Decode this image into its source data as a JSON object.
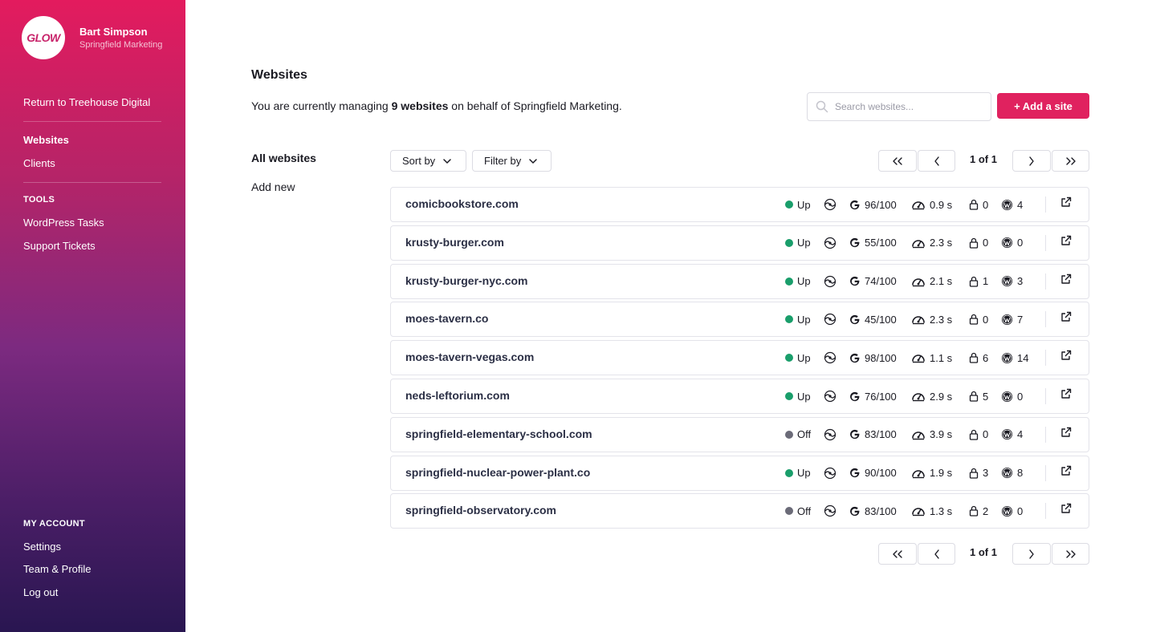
{
  "sidebar": {
    "logo_text": "GLOW",
    "user_name": "Bart Simpson",
    "user_org": "Springfield Marketing",
    "return_link": "Return to Treehouse Digital",
    "nav": [
      "Websites",
      "Clients"
    ],
    "tools_heading": "TOOLS",
    "tools": [
      "WordPress Tasks",
      "Support Tickets"
    ],
    "account_heading": "MY ACCOUNT",
    "account": [
      "Settings",
      "Team & Profile",
      "Log out"
    ]
  },
  "header": {
    "title": "Websites",
    "subtitle_prefix": "You are currently managing ",
    "subtitle_count": "9 websites",
    "subtitle_suffix": " on behalf of Springfield Marketing.",
    "search_placeholder": "Search websites...",
    "add_button": "+ Add a site"
  },
  "subnav": {
    "title": "All websites",
    "add_new": "Add new"
  },
  "toolbar": {
    "sort_label": "Sort by",
    "filter_label": "Filter by"
  },
  "pagination": {
    "label": "1 of 1"
  },
  "colors": {
    "accent": "#e0225f",
    "status_up": "#1a9e6b",
    "status_off": "#6b6b78"
  },
  "websites": [
    {
      "domain": "comicbookstore.com",
      "status": "Up",
      "pagespeed": "96/100",
      "load_time": "0.9 s",
      "security": "0",
      "wp_updates": "4"
    },
    {
      "domain": "krusty-burger.com",
      "status": "Up",
      "pagespeed": "55/100",
      "load_time": "2.3 s",
      "security": "0",
      "wp_updates": "0"
    },
    {
      "domain": "krusty-burger-nyc.com",
      "status": "Up",
      "pagespeed": "74/100",
      "load_time": "2.1 s",
      "security": "1",
      "wp_updates": "3"
    },
    {
      "domain": "moes-tavern.co",
      "status": "Up",
      "pagespeed": "45/100",
      "load_time": "2.3 s",
      "security": "0",
      "wp_updates": "7"
    },
    {
      "domain": "moes-tavern-vegas.com",
      "status": "Up",
      "pagespeed": "98/100",
      "load_time": "1.1 s",
      "security": "6",
      "wp_updates": "14"
    },
    {
      "domain": "neds-leftorium.com",
      "status": "Up",
      "pagespeed": "76/100",
      "load_time": "2.9 s",
      "security": "5",
      "wp_updates": "0"
    },
    {
      "domain": "springfield-elementary-school.com",
      "status": "Off",
      "pagespeed": "83/100",
      "load_time": "3.9 s",
      "security": "0",
      "wp_updates": "4"
    },
    {
      "domain": "springfield-nuclear-power-plant.co",
      "status": "Up",
      "pagespeed": "90/100",
      "load_time": "1.9 s",
      "security": "3",
      "wp_updates": "8"
    },
    {
      "domain": "springfield-observatory.com",
      "status": "Off",
      "pagespeed": "83/100",
      "load_time": "1.3 s",
      "security": "2",
      "wp_updates": "0"
    }
  ]
}
